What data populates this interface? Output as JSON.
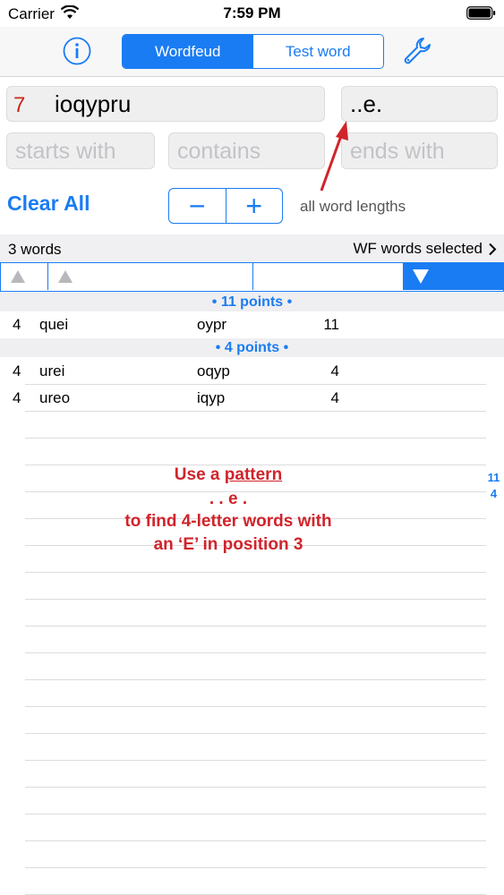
{
  "status_bar": {
    "carrier": "Carrier",
    "time": "7:59 PM"
  },
  "toolbar": {
    "segments": [
      {
        "label": "Wordfeud",
        "selected": true
      },
      {
        "label": "Test word",
        "selected": false
      }
    ],
    "accent_color": "#1a7cf2"
  },
  "input": {
    "rack_count": "7",
    "rack_letters": "ioqypru",
    "pattern": "..e.",
    "starts_with_placeholder": "starts with",
    "contains_placeholder": "contains",
    "ends_with_placeholder": "ends with"
  },
  "controls": {
    "clear_all": "Clear All",
    "minus": "−",
    "plus": "+",
    "lengths_label": "all word lengths"
  },
  "summary": {
    "count": "3 words",
    "dictionary": "WF words selected"
  },
  "results": {
    "groups": [
      {
        "header": "• 11 points •",
        "rows": [
          {
            "length": "4",
            "word": "quei",
            "remaining": "oypr",
            "points": "11"
          }
        ]
      },
      {
        "header": "• 4 points •",
        "rows": [
          {
            "length": "4",
            "word": "urei",
            "remaining": "oqyp",
            "points": "4"
          },
          {
            "length": "4",
            "word": "ureo",
            "remaining": "iqyp",
            "points": "4"
          }
        ]
      }
    ]
  },
  "annotation": {
    "line1_prefix": "Use a ",
    "line1_link": "pattern",
    "line2": ". . e .",
    "line3": "to find 4-letter words with",
    "line4": "an ‘E’ in position 3",
    "color": "#d0242b"
  },
  "section_index": [
    "11",
    "4"
  ]
}
